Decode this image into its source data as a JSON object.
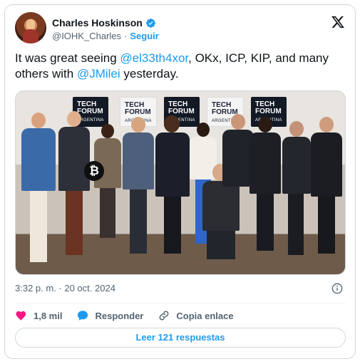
{
  "author": {
    "name": "Charles Hoskinson",
    "handle": "@IOHK_Charles",
    "separator": "·",
    "follow_label": "Seguir"
  },
  "tweet": {
    "text_parts": [
      {
        "type": "text",
        "value": "It was great seeing "
      },
      {
        "type": "mention",
        "value": "@el33th4xor"
      },
      {
        "type": "text",
        "value": ", OKx, ICP, KIP, and many others with "
      },
      {
        "type": "mention",
        "value": "@JMilei"
      },
      {
        "type": "text",
        "value": " yesterday."
      }
    ]
  },
  "photo": {
    "banners": [
      {
        "line1": "TECH",
        "line2": "FORUM",
        "line3": "ARGENTINA"
      },
      {
        "line1": "TECH",
        "line2": "FORUM",
        "line3": "ARGENTINA"
      },
      {
        "line1": "TECH",
        "line2": "FORUM",
        "line3": "ARGENTINA"
      },
      {
        "line1": "TECH",
        "line2": "FORUM",
        "line3": "ARGENTINA"
      },
      {
        "line1": "TECH",
        "line2": "FORUM",
        "line3": "ARGENTINA"
      }
    ],
    "badge_symbol": "₿"
  },
  "meta": {
    "timestamp": "3:32 p. m. · 20 oct. 2024"
  },
  "actions": {
    "likes": "1,8 mil",
    "reply_label": "Responder",
    "copy_label": "Copia enlace"
  },
  "footer": {
    "read_replies_label": "Leer 121 respuestas"
  },
  "colors": {
    "accent": "#1d9bf0",
    "like": "#f91880",
    "text": "#0f1419",
    "muted": "#536471",
    "border": "#cfd9de"
  },
  "icons": [
    "verified-badge-icon",
    "x-logo-icon",
    "info-icon",
    "heart-icon",
    "reply-bubble-icon",
    "link-icon"
  ]
}
